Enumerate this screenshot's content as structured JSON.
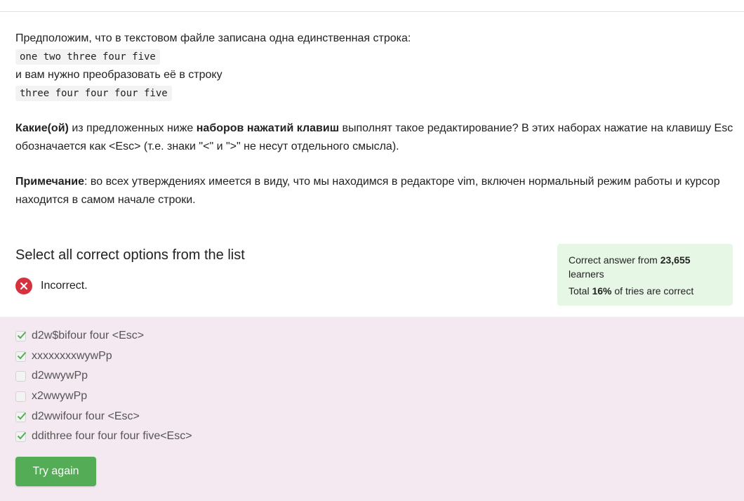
{
  "question": {
    "line1": "Предположим, что в текстовом файле записана одна единственная строка:",
    "code1": "one two three four five",
    "line2": "и вам нужно преобразовать её в строку",
    "code2": "three four four four five",
    "p2_bold1": "Какие(ой)",
    "p2_text1": " из предложенных ниже ",
    "p2_bold2": "наборов нажатий клавиш",
    "p2_text2": " выполнят такое редактирование? В этих наборах нажатие на клавишу Esc обозначается как <Esc> (т.е. знаки \"<\" и \">\" не несут отдельного смысла).",
    "p3_bold": "Примечание",
    "p3_text": ": во всех утверждениях имеется в виду, что мы находимся в редакторе vim, включен нормальный режим работы и курсор находится в самом начале строки."
  },
  "header": {
    "title": "Select all correct options from the list"
  },
  "status": {
    "label": "Incorrect."
  },
  "stats": {
    "line1_prefix": "Correct answer from ",
    "learners_count": "23,655",
    "line1_suffix": " learners",
    "line2_prefix": "Total ",
    "percent": "16%",
    "line2_suffix": " of tries are correct"
  },
  "options": [
    {
      "label": "d2w$bifour four <Esc>",
      "checked": true
    },
    {
      "label": "xxxxxxxxwywPp",
      "checked": true
    },
    {
      "label": "d2wwywPp",
      "checked": false
    },
    {
      "label": "x2wwywPp",
      "checked": false
    },
    {
      "label": "d2wwifour four <Esc>",
      "checked": true
    },
    {
      "label": "ddithree four four four five<Esc>",
      "checked": true
    }
  ],
  "button": {
    "label": "Try again"
  },
  "colors": {
    "incorrect": "#d6313d",
    "check": "#54ad56",
    "stats_bg": "#e7f7e6",
    "options_bg": "#f5e9f1",
    "button_bg": "#54ad56"
  },
  "icons": {
    "status": "x-circle-icon",
    "check": "checkmark-icon"
  }
}
